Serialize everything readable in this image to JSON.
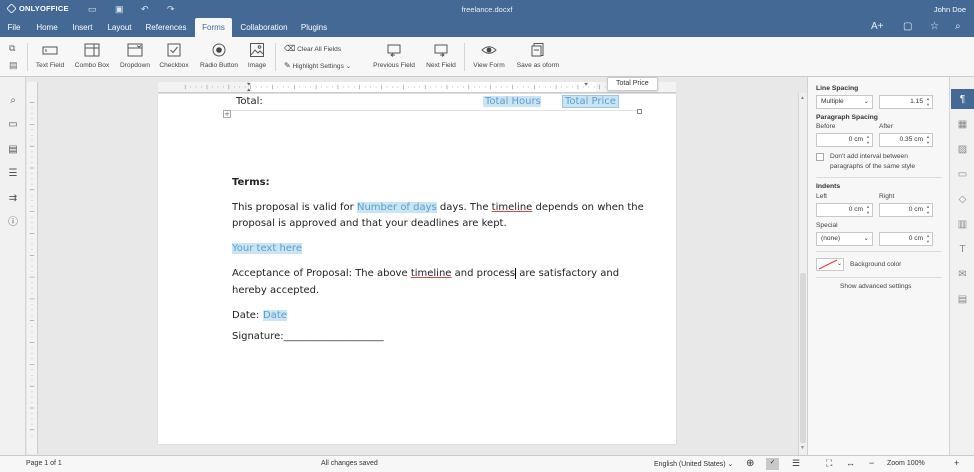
{
  "app": {
    "logo_text": "ONLYOFFICE",
    "doc_title": "freelance.docxf",
    "user": "John Doe"
  },
  "menu": {
    "tabs": [
      {
        "label": "File"
      },
      {
        "label": "Home"
      },
      {
        "label": "Insert"
      },
      {
        "label": "Layout"
      },
      {
        "label": "References"
      },
      {
        "label": "Forms"
      },
      {
        "label": "Collaboration"
      },
      {
        "label": "Plugins"
      }
    ],
    "active": "Forms"
  },
  "toolbar": {
    "text_field": "Text Field",
    "combo_box": "Combo Box",
    "dropdown": "Dropdown",
    "checkbox": "Checkbox",
    "radio_button": "Radio Button",
    "image": "Image",
    "clear_all_fields": "Clear All Fields",
    "highlight_settings": "Highlight Settings",
    "previous_field": "Previous Field",
    "next_field": "Next Field",
    "view_form": "View Form",
    "save_as_oform": "Save as oform"
  },
  "tooltip": "Total Price",
  "document": {
    "total_label": "Total:",
    "total_hours_field": "Total Hours",
    "total_price_field": "Total Price",
    "terms_heading": "Terms:",
    "terms_p1_a": "This proposal is valid for ",
    "terms_field_days": "Number of days",
    "terms_p1_b": " days. The ",
    "terms_p1_timeline": "timeline",
    "terms_p1_c": " depends on when the",
    "terms_p1_line2": "proposal is approved and that your deadlines are kept.",
    "your_text_field": "Your text here",
    "accept_a": "Acceptance of Proposal: The above ",
    "accept_timeline": "timeline",
    "accept_b": " and process",
    "accept_c": " are satisfactory and",
    "accept_line2": "hereby accepted.",
    "date_label": "Date:",
    "date_field": "Date",
    "signature_label": "Signature:____________________"
  },
  "right_panel": {
    "line_spacing_label": "Line Spacing",
    "line_spacing_mode": "Multiple",
    "line_spacing_value": "1.15",
    "paragraph_spacing_label": "Paragraph Spacing",
    "before_label": "Before",
    "after_label": "After",
    "before_value": "0 cm",
    "after_value": "0.35 cm",
    "dont_add_interval_line1": "Don't add interval between",
    "dont_add_interval_line2": "paragraphs of the same style",
    "indents_label": "Indents",
    "left_label": "Left",
    "right_label": "Right",
    "left_value": "0 cm",
    "right_value": "0 cm",
    "special_label": "Special",
    "special_value": "(none)",
    "special_indent_value": "0 cm",
    "background_color_label": "Background color",
    "show_advanced": "Show advanced settings"
  },
  "status": {
    "page": "Page 1 of 1",
    "saved": "All changes saved",
    "language": "English (United States)",
    "zoom": "Zoom 100%"
  },
  "colors": {
    "brand": "#446995",
    "field_bg": "#c9e5f3",
    "field_text": "#5c9fcd"
  }
}
